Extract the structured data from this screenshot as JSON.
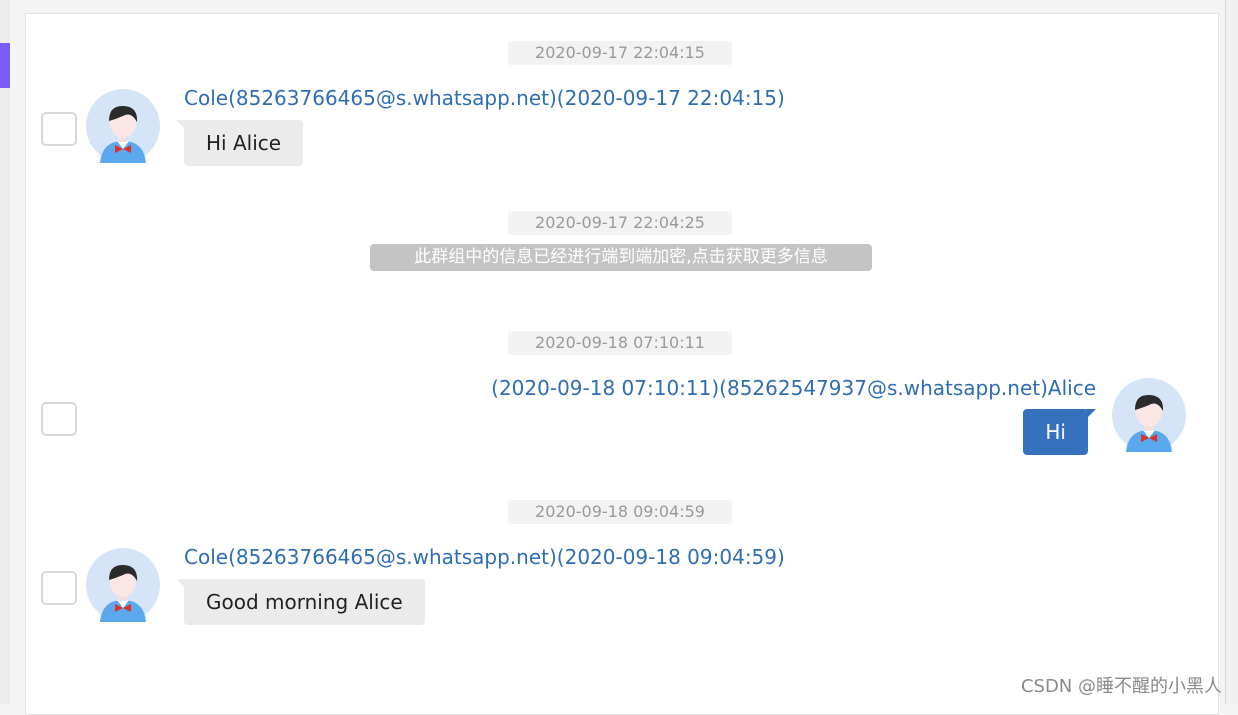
{
  "messages": [
    {
      "timestamp": "2020-09-17 22:04:15",
      "header": "Cole(85263766465@s.whatsapp.net)(2020-09-17 22:04:15)",
      "text": "Hi Alice"
    },
    {
      "timestamp": "2020-09-17 22:04:25",
      "notice": "此群组中的信息已经进行端到端加密,点击获取更多信息"
    },
    {
      "timestamp": "2020-09-18 07:10:11",
      "header": "(2020-09-18 07:10:11)(85262547937@s.whatsapp.net)Alice",
      "text": "Hi"
    },
    {
      "timestamp": "2020-09-18 09:04:59",
      "header": "Cole(85263766465@s.whatsapp.net)(2020-09-18 09:04:59)",
      "text": "Good morning Alice"
    }
  ],
  "watermark": "CSDN @睡不醒的小黑人",
  "colors": {
    "accent": "#7b5cf5",
    "sender_link": "#2f6db3",
    "outgoing_bubble": "#3571bc",
    "incoming_bubble": "#ebebeb",
    "avatar_bg": "#d6e4f7"
  }
}
